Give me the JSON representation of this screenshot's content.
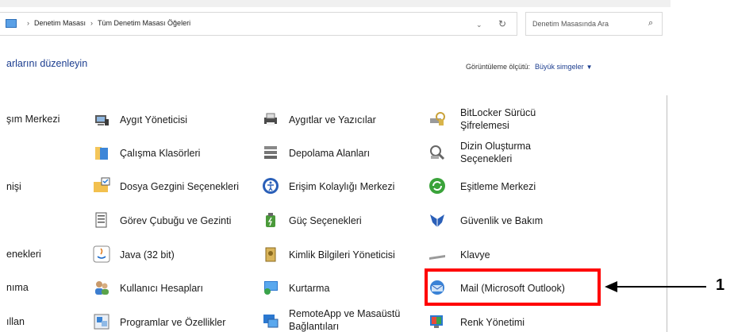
{
  "breadcrumb": [
    "Denetim Masası",
    "Tüm Denetim Masası Öğeleri"
  ],
  "search": {
    "placeholder": "Denetim Masasında Ara"
  },
  "heading": "arlarını düzenleyin",
  "view_by": {
    "label": "Görüntüleme ölçütü:",
    "value": "Büyük simgeler"
  },
  "col1": [
    {
      "label": "şım Merkezi"
    },
    {
      "label": "nişi"
    },
    {
      "label": "enekleri"
    },
    {
      "label": "nıma"
    },
    {
      "label": "ıllan"
    }
  ],
  "col2": [
    {
      "label": "Aygıt Yöneticisi",
      "icon": "device-manager-icon"
    },
    {
      "label": "Çalışma Klasörleri",
      "icon": "work-folders-icon"
    },
    {
      "label": "Dosya Gezgini Seçenekleri",
      "icon": "file-explorer-options-icon"
    },
    {
      "label": "Görev Çubuğu ve Gezinti",
      "icon": "taskbar-icon"
    },
    {
      "label": "Java (32 bit)",
      "icon": "java-icon"
    },
    {
      "label": "Kullanıcı Hesapları",
      "icon": "user-accounts-icon"
    },
    {
      "label": "Programlar ve Özellikler",
      "icon": "programs-features-icon"
    }
  ],
  "col3": [
    {
      "label": "Aygıtlar ve Yazıcılar",
      "icon": "devices-printers-icon"
    },
    {
      "label": "Depolama Alanları",
      "icon": "storage-spaces-icon"
    },
    {
      "label": "Erişim Kolaylığı Merkezi",
      "icon": "ease-of-access-icon"
    },
    {
      "label": "Güç Seçenekleri",
      "icon": "power-options-icon"
    },
    {
      "label": "Kimlik Bilgileri Yöneticisi",
      "icon": "credential-manager-icon"
    },
    {
      "label": "Kurtarma",
      "icon": "recovery-icon"
    },
    {
      "line1": "RemoteApp ve Masaüstü",
      "line2": "Bağlantıları",
      "icon": "remoteapp-icon"
    }
  ],
  "col4": [
    {
      "line1": "BitLocker Sürücü",
      "line2": "Şifrelemesi",
      "icon": "bitlocker-icon"
    },
    {
      "line1": "Dizin Oluşturma",
      "line2": "Seçenekleri",
      "icon": "indexing-options-icon"
    },
    {
      "label": "Eşitleme Merkezi",
      "icon": "sync-center-icon"
    },
    {
      "label": "Güvenlik ve Bakım",
      "icon": "security-maintenance-icon"
    },
    {
      "label": "Klavye",
      "icon": "keyboard-icon"
    },
    {
      "label": "Mail (Microsoft Outlook)",
      "icon": "mail-icon"
    },
    {
      "label": "Renk Yönetimi",
      "icon": "color-management-icon"
    }
  ],
  "callout": "1",
  "colors": {
    "link": "#1b3d8f",
    "highlight": "#ff0000"
  }
}
